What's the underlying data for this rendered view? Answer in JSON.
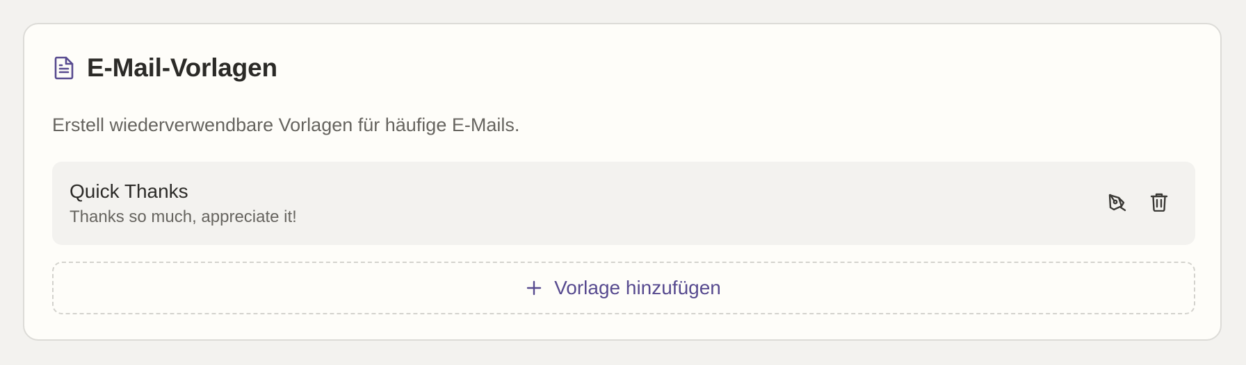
{
  "section": {
    "title": "E-Mail-Vorlagen",
    "icon": "document-icon",
    "description": "Erstell wiederverwendbare Vorlagen für häufige E-Mails."
  },
  "templates": [
    {
      "name": "Quick Thanks",
      "preview": "Thanks so much, appreciate it!",
      "actions": {
        "edit_icon": "pen-icon",
        "delete_icon": "trash-icon"
      }
    }
  ],
  "add_button": {
    "label": "Vorlage hinzufügen",
    "icon": "plus-icon"
  },
  "colors": {
    "page_background": "#f3f2ef",
    "card_background": "#fefdf9",
    "accent": "#574a8f",
    "title_text": "#2b2a27",
    "muted_text": "#66645f",
    "item_background": "#f3f2ef"
  }
}
